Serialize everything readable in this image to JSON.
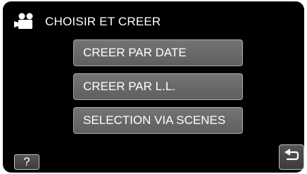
{
  "header": {
    "title": "CHOISIR ET CREER",
    "icon": "video-camera-icon"
  },
  "menu": {
    "items": [
      {
        "label": "CREER PAR DATE"
      },
      {
        "label": "CREER PAR L.L."
      },
      {
        "label": "SELECTION VIA SCENES"
      }
    ]
  },
  "footer": {
    "help_label": "?",
    "back_icon": "return-arrow-icon"
  },
  "colors": {
    "background": "#000000",
    "button": "#6a6a6a",
    "button_border": "#a9a9a9",
    "text": "#ffffff"
  }
}
